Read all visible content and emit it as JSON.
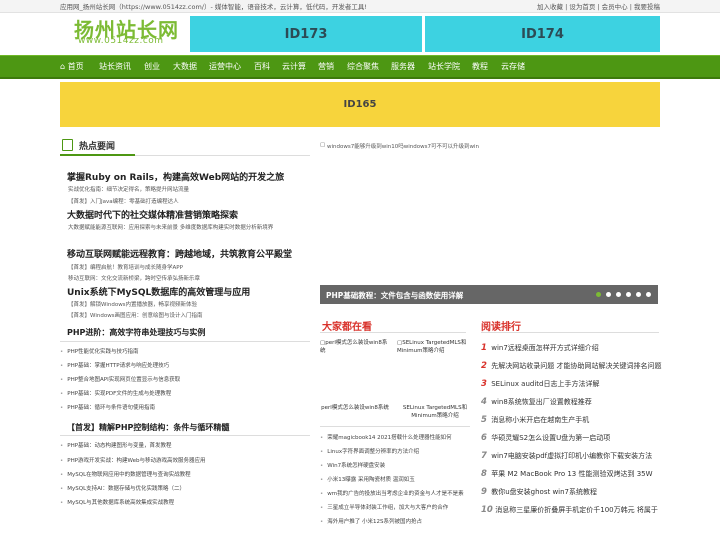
{
  "topbar": {
    "left": "应用网_扬州站长网（https://www.0514zz.com/）- 媒体智能，语音技术，云计算，低代码，开发者工具!",
    "right": "加入收藏 | 设为首页 | 会员中心 | 我要投稿"
  },
  "logo": {
    "main": "扬州站长网",
    "sub": "www.0514zz.com"
  },
  "ads": {
    "a": "ID173",
    "b": "ID174",
    "banner": "ID165"
  },
  "nav": [
    "首页",
    "站长资讯",
    "创业",
    "大数据",
    "运营中心",
    "百科",
    "云计算",
    "营销",
    "综合聚焦",
    "服务器",
    "站长学院",
    "教程",
    "云存储"
  ],
  "hot": {
    "title": "热点要闻",
    "items": [
      {
        "title": "掌握Ruby on Rails，构建高效Web网站的开发之旅",
        "subs": [
          "实战优化指南：细节决定得名，策略提升网站流量",
          "【首发】入门Java编程：零基础打造编程达人"
        ]
      },
      {
        "title": "大数据时代下的社交媒体精准营销策略探索",
        "subs": [
          "大数据赋能能源互联网：应用探索与未来前景   多维度数据库构建实时数据分析新境界"
        ]
      },
      {
        "title": "移动互联网赋能远程教育：跨越地域，共筑教育公平殿堂",
        "subs": [
          "【首发】编程启航！教育培训与成长随身学APP",
          "移动互联网：文化交流新桥梁，跨时空传承弘扬新乐章"
        ]
      },
      {
        "title": "Unix系统下MySQL数据库的高效管理与应用",
        "subs": [
          "【首发】解锁Windows内置播放器，畅享视频新体验",
          "【首发】Windows画图应用：创意绘图与设计入门指南"
        ]
      }
    ],
    "php1": {
      "title": "PHP进阶：高效字符串处理技巧与实例",
      "list": [
        "PHP性能优化实践与技巧指南",
        "PHP基础：掌握HTTP请求与响应处理技巧",
        "PHP整合地图API实现网页位置显示与信息获取",
        "PHP基础：实现PDF文件的生成与处理教程",
        "PHP基础：循环与条件语句使用指南"
      ]
    },
    "php2": {
      "title": "【首发】精解PHP控制结构：条件与循环精髓",
      "list": [
        "PHP基础：动态构建图形与变量，首发教程",
        "PHP游戏开发实战：构建Web与移动游戏高效服务器应用",
        "MySQL在物联网应用中的数据管理与查询实战教程",
        "MySQL支持AI：数据存储与优化实践策略（二）",
        "MySQL与其他数据库系统高效集成实战教程"
      ]
    }
  },
  "slide": {
    "alt": "windows7能够升级到win10吗windows7可不可以升级到win",
    "caption": "PHP基础教程：文件包含与函数使用详解"
  },
  "dajia": {
    "title": "大家都在看",
    "thumbs": [
      "perl模式怎么装设win8系统",
      "SELinux TargetedMLS和Minimum策略介绍",
      "perl模式怎么装设win8系统",
      "SELinux TargetedMLS和Minimum策略介绍"
    ],
    "list": [
      "荣耀magicbook14 2021搭载什么处理器性能如何",
      "Linux字符界面调整分辨率的方法介绍",
      "Win7系统怎样硬盘安装",
      "小米13曝露 采用陶瓷材质 温润如玉",
      "wm我的广告的投放出当考虑企业的资金与人才是不是素",
      "三星成立半导体封装工作组，加大与大客户的合作",
      "海外用户推了 小米12S系列被国内抢占"
    ]
  },
  "rank": {
    "title": "阅读排行",
    "items": [
      "win7远程桌面怎样开方式详细介绍",
      "先解决网站收录问题 才能协助网站解决关键词排名问题",
      "SELinux auditd日志上手方法详解",
      "win8系统恢复出厂设置教程推荐",
      "消息称小米开启在越南生产手机",
      "华硕灵耀S2怎么设置U盘为第一启动项",
      "win7电脑安装pdf虚拟打印机小编教你下载安装方法",
      "苹果 M2 MacBook Pro 13 性能测验双烤达到 35W",
      "教你u盘安装ghost win7系统教程",
      "消息称三星廉价折叠屏手机定价千100万韩元 将属于"
    ]
  },
  "colors": {
    "green": "#4d9713",
    "cyan": "#3dd2e1",
    "yellow": "#f7d43c",
    "red": "#d9322b"
  }
}
